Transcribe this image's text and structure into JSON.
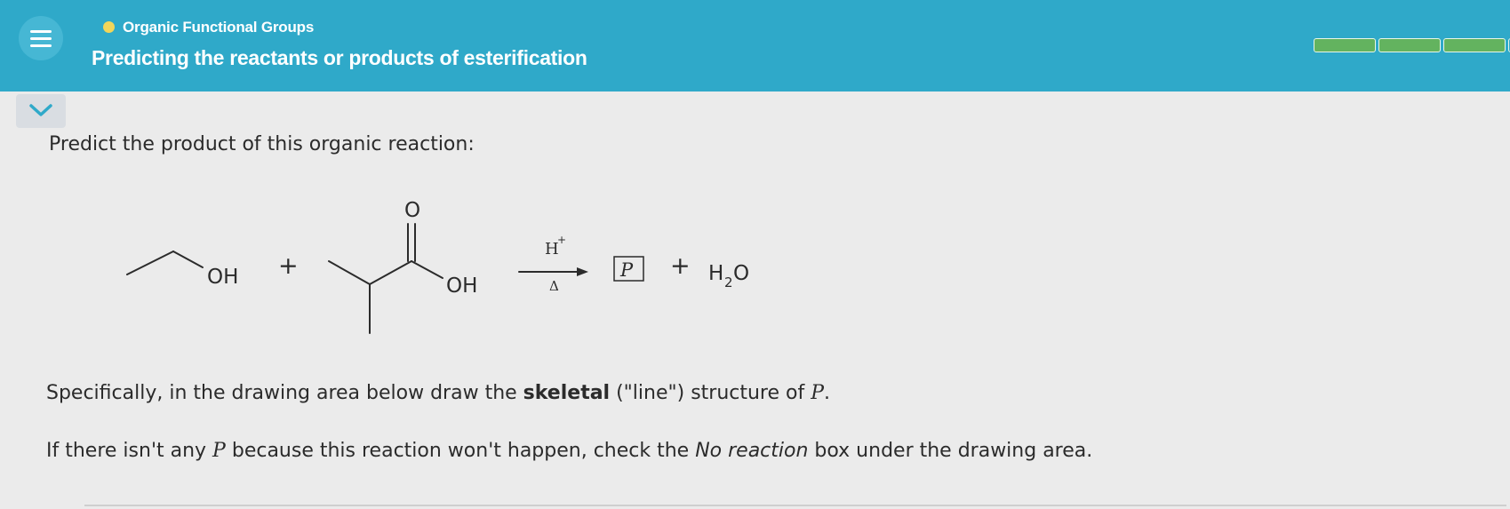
{
  "header": {
    "topic": "Organic Functional Groups",
    "title": "Predicting the reactants or products of esterification",
    "progress": {
      "filled_segments": 3,
      "total_segments": 4
    }
  },
  "question": {
    "prompt": "Predict the product of this organic reaction:",
    "reaction": {
      "reactant1_label": "OH",
      "plus1": "+",
      "carbonyl_o": "O",
      "reactant2_label": "OH",
      "catalyst": "H",
      "catalyst_charge": "+",
      "heat": "Δ",
      "product_label": "P",
      "plus2": "+",
      "water_h": "H",
      "water_sub": "2",
      "water_o": "O"
    },
    "instruction1": {
      "pre": "Specifically, in the drawing area below draw the ",
      "bold": "skeletal",
      "mid": " (\"line\") structure of ",
      "var": "P",
      "post": "."
    },
    "instruction2": {
      "pre": "If there isn't any ",
      "var": "P",
      "mid": " because this reaction won't happen, check the ",
      "italic": "No reaction",
      "post": " box under the drawing area."
    }
  }
}
